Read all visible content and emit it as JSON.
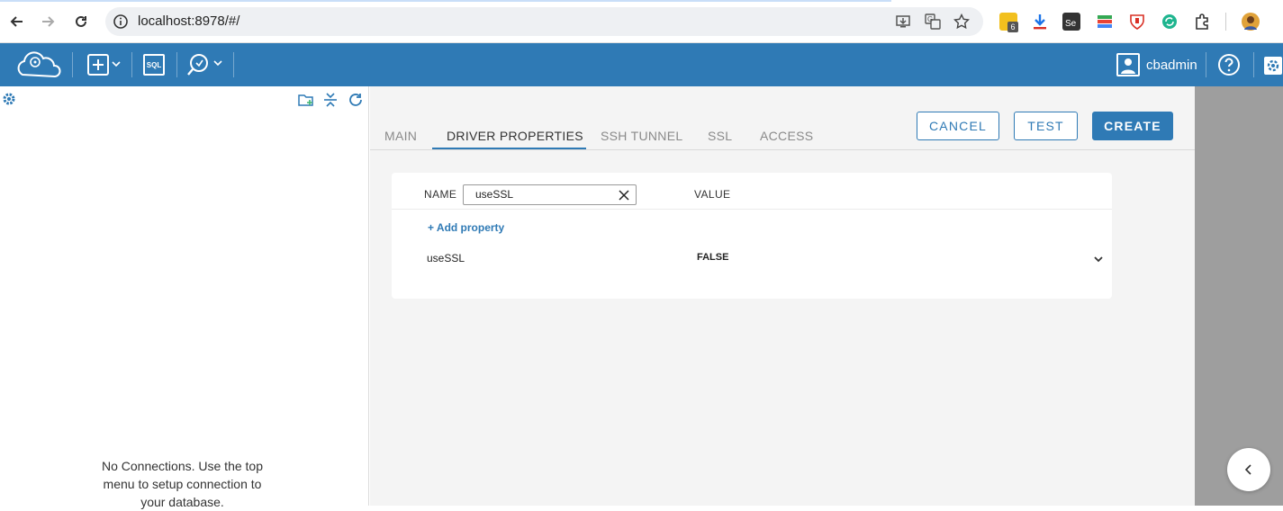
{
  "browser": {
    "url": "localhost:8978/#/",
    "extension_badge": "6"
  },
  "header": {
    "sql_label": "SQL",
    "user_name": "cbadmin"
  },
  "left_panel": {
    "empty_message": "No Connections. Use the top menu to setup connection to your database."
  },
  "tabs": [
    {
      "label": "MAIN"
    },
    {
      "label": "DRIVER PROPERTIES"
    },
    {
      "label": "SSH TUNNEL"
    },
    {
      "label": "SSL"
    },
    {
      "label": "ACCESS"
    }
  ],
  "active_tab": "DRIVER PROPERTIES",
  "actions": {
    "cancel": "CANCEL",
    "test": "TEST",
    "create": "CREATE"
  },
  "properties": {
    "name_header": "NAME",
    "value_header": "VALUE",
    "filter_value": "useSSL",
    "add_label": "+ Add property",
    "rows": [
      {
        "name": "useSSL",
        "value": "FALSE"
      }
    ]
  },
  "colors": {
    "brand": "#2f7ab5"
  }
}
